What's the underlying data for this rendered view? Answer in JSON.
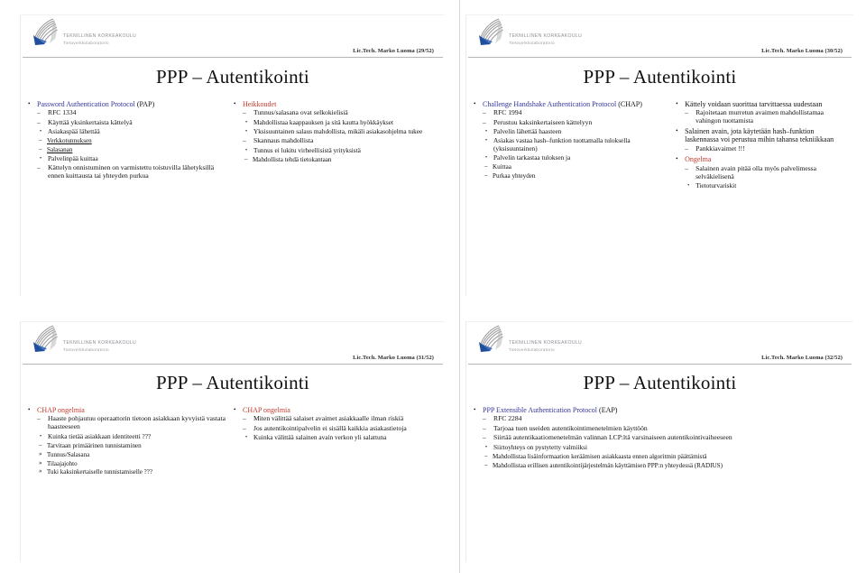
{
  "deck": {
    "logo": {
      "org_line1": "TEKNILLINEN KORKEAKOULU",
      "org_line2": "Tietoverkkolaboratorio",
      "mark_name": "tkk-fan-logo"
    },
    "colors": {
      "heading_blue": "#33339a",
      "warning_red": "#c0392b",
      "text": "#111111",
      "rule": "#b6b6b6"
    }
  },
  "slides": [
    {
      "id": "slide-29",
      "page_label": "Lic.Tech. Marko Luoma (29/52)",
      "title": "PPP – Autentikointi",
      "columns": [
        {
          "items": [
            {
              "level": 1,
              "marker": "•",
              "color": "blue",
              "text": "Password Authentication Protocol",
              "tail": "(PAP)",
              "tail_color": "text"
            },
            {
              "level": 2,
              "marker": "–",
              "text": "RFC 1334"
            },
            {
              "level": 2,
              "marker": "–",
              "text": "Käyttää yksinkertaista kättelyä"
            },
            {
              "level": 3,
              "marker": "•",
              "text": "Asiakaspää lähettää"
            },
            {
              "level": 4,
              "marker": "–",
              "text": "Verkkotunnuksen",
              "underline": true
            },
            {
              "level": 4,
              "marker": "–",
              "text": "Salasanan",
              "underline": true
            },
            {
              "level": 3,
              "marker": "•",
              "text": "Palvelinpää kuittaa"
            },
            {
              "level": 2,
              "marker": "–",
              "text": "Kättelyn onnistuminen on varmistettu toistuvilla lähetyksillä ennen kuittausta tai yhteyden purkua"
            }
          ]
        },
        {
          "items": [
            {
              "level": 1,
              "marker": "•",
              "color": "red",
              "text": "Heikkoudet"
            },
            {
              "level": 2,
              "marker": "–",
              "text": "Tunnus/salasana ovat selkokielisiä"
            },
            {
              "level": 3,
              "marker": "•",
              "text": "Mahdollistaa kaappauksen ja sitä kautta hyökkäykset"
            },
            {
              "level": 3,
              "marker": "•",
              "text": "Yksisuuntainen salaus mahdollista, mikäli asiakasohjelma tukee"
            },
            {
              "level": 2,
              "marker": "–",
              "text": "Skannaus mahdollista"
            },
            {
              "level": 3,
              "marker": "•",
              "text": "Tunnus ei lukitu virheellisistä yrityksistä"
            },
            {
              "level": 4,
              "marker": "–",
              "text": "Mahdollista tehdä tietokantaan"
            }
          ]
        }
      ]
    },
    {
      "id": "slide-30",
      "page_label": "Lic.Tech. Marko Luoma (30/52)",
      "title": "PPP – Autentikointi",
      "columns": [
        {
          "items": [
            {
              "level": 1,
              "marker": "•",
              "color": "blue",
              "text": "Challenge Handshake Authentication Protocol",
              "tail": "(CHAP)",
              "tail_color": "text"
            },
            {
              "level": 2,
              "marker": "–",
              "text": "RFC 1994"
            },
            {
              "level": 2,
              "marker": "–",
              "text": "Perustuu kaksinkertaiseen kättelyyn"
            },
            {
              "level": 3,
              "marker": "•",
              "text": "Palvelin lähettää haasteen"
            },
            {
              "level": 3,
              "marker": "•",
              "text": "Asiakas vastaa hash–funktion tuottamalla tuloksella (yksisuuntainen)"
            },
            {
              "level": 3,
              "marker": "•",
              "text": "Palvelin tarkastaa tuloksen ja"
            },
            {
              "level": 4,
              "marker": "–",
              "text": "Kuittaa"
            },
            {
              "level": 4,
              "marker": "–",
              "text": "Purkaa yhteyden"
            }
          ]
        },
        {
          "items": [
            {
              "level": 1,
              "marker": "•",
              "text": "Kättely voidaan suorittaa tarvittaessa uudestaan"
            },
            {
              "level": 2,
              "marker": "–",
              "text": "Rajoitetaan murretun avaimen mahdollistamaa vahingon tuottamista"
            },
            {
              "level": 1,
              "marker": "•",
              "text": "Salainen avain, jota käytetään hash–funktion laskennassa voi perustua mihin tahansa tekniikkaan"
            },
            {
              "level": 2,
              "marker": "–",
              "text": "Pankkiavaimet !!!"
            },
            {
              "level": 1,
              "marker": "•",
              "color": "red",
              "text": "Ongelma"
            },
            {
              "level": 2,
              "marker": "–",
              "text": "Salainen avain pitää olla myös palvelimessa selväkielisenä"
            },
            {
              "level": 3,
              "marker": "•",
              "text": "Tietoturvariskit"
            }
          ]
        }
      ]
    },
    {
      "id": "slide-31",
      "page_label": "Lic.Tech. Marko Luoma (31/52)",
      "title": "PPP – Autentikointi",
      "columns": [
        {
          "items": [
            {
              "level": 1,
              "marker": "•",
              "color": "red",
              "text": "CHAP ongelmia"
            },
            {
              "level": 2,
              "marker": "–",
              "text": "Haaste pohjautuu operaattorin tietoon asiakkaan kyvyistä vastata haasteeseen"
            },
            {
              "level": 3,
              "marker": "•",
              "text": "Kuinka tietää asiakkaan identiteetti ???"
            },
            {
              "level": 4,
              "marker": "–",
              "text": "Tarvitaan primäärinen tunnistaminen"
            },
            {
              "level": 5,
              "marker": "»",
              "text": "Tunnus/Salasana"
            },
            {
              "level": 5,
              "marker": "»",
              "text": "Tilaajajohto"
            },
            {
              "level": 5,
              "marker": "»",
              "text": "Tuki kaksinkertaiselle tunnistamiselle ???"
            }
          ]
        },
        {
          "items": [
            {
              "level": 1,
              "marker": "•",
              "color": "red",
              "text": "CHAP ongelmia"
            },
            {
              "level": 2,
              "marker": "–",
              "text": "Miten välittää salaiset avaimet asiakkaalle ilman riskiä"
            },
            {
              "level": 2,
              "marker": "–",
              "text": "Jos autentikointipalvelin ei sisällä kaikkia asiakastietoja"
            },
            {
              "level": 3,
              "marker": "•",
              "text": "Kuinka välittää salainen avain verkon yli salattuna"
            }
          ]
        }
      ]
    },
    {
      "id": "slide-32",
      "page_label": "Lic.Tech. Marko Luoma (32/52)",
      "title": "PPP – Autentikointi",
      "columns": [
        {
          "items": [
            {
              "level": 1,
              "marker": "•",
              "color": "blue",
              "text": "PPP Extensible Authentication Protocol",
              "tail": "(EAP)",
              "tail_color": "text"
            },
            {
              "level": 2,
              "marker": "–",
              "text": "RFC 2284"
            },
            {
              "level": 2,
              "marker": "–",
              "text": "Tarjoaa tuen useiden autentikointimenetelmien käyttöön"
            },
            {
              "level": 2,
              "marker": "–",
              "text": "Siirtää autentikaatiomenetelmän valinnan LCP:ltä varsinaiseen autentikointivaiheeseen"
            },
            {
              "level": 3,
              "marker": "•",
              "text": "Siirtoyhteys on pystytetty valmiiksi"
            },
            {
              "level": 4,
              "marker": "–",
              "text": "Mahdollistaa lisäinformaation keräämisen asiakkaasta ennen algoritmin päättämistä"
            },
            {
              "level": 4,
              "marker": "–",
              "text": "Mahdollistaa erillisen autentikointijärjestelmän käyttämisen PPP:n yhteydessä (RADIUS)"
            }
          ]
        }
      ]
    }
  ]
}
